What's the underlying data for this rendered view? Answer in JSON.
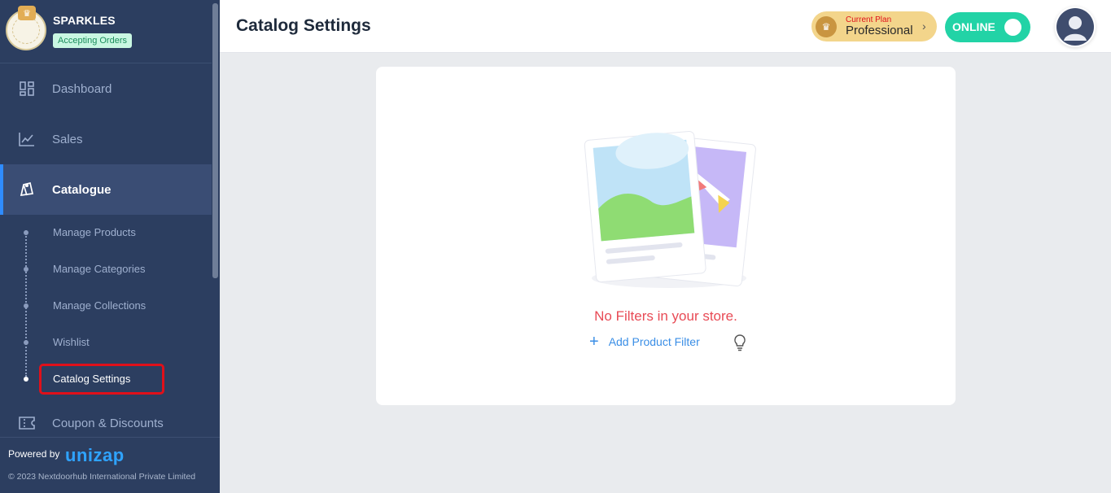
{
  "store": {
    "name": "SPARKLES",
    "status": "Accepting Orders"
  },
  "sidebar": {
    "items": [
      {
        "label": "Dashboard",
        "icon": "dashboard-icon"
      },
      {
        "label": "Sales",
        "icon": "chart-line-icon"
      },
      {
        "label": "Catalogue",
        "icon": "catalogue-icon"
      },
      {
        "label": "Coupon & Discounts",
        "icon": "coupon-icon"
      }
    ],
    "sub_items": [
      {
        "label": "Manage Products"
      },
      {
        "label": "Manage Categories"
      },
      {
        "label": "Manage Collections"
      },
      {
        "label": "Wishlist"
      },
      {
        "label": "Catalog Settings"
      }
    ],
    "footer": {
      "powered_by": "Powered by",
      "brand": "unizap",
      "copyright": "© 2023 Nextdoorhub International Private Limited"
    }
  },
  "header": {
    "title": "Catalog Settings",
    "plan": {
      "label": "Current Plan",
      "name": "Professional"
    },
    "online_label": "ONLINE"
  },
  "main": {
    "empty_message": "No Filters in your store.",
    "add_filter_label": "Add Product Filter"
  },
  "colors": {
    "sidebar_bg": "#2c3e60",
    "accent_blue": "#3a8ee6",
    "online_green": "#22d3a6",
    "empty_red": "#e84a55",
    "plan_gold": "#f3d58b"
  }
}
